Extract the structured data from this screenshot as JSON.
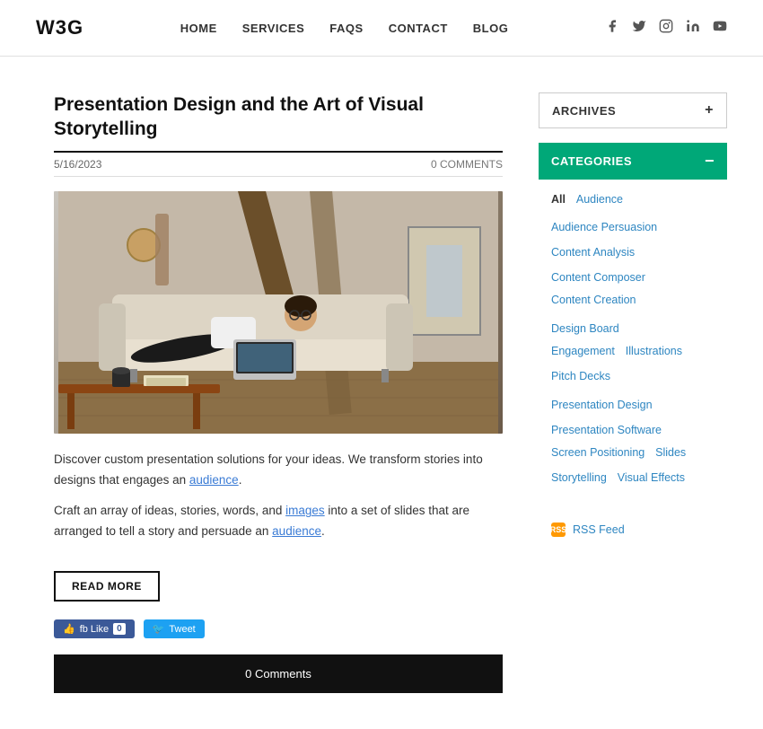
{
  "header": {
    "logo": "W3G",
    "nav": [
      {
        "label": "HOME",
        "href": "#"
      },
      {
        "label": "SERVICES",
        "href": "#"
      },
      {
        "label": "FAQS",
        "href": "#"
      },
      {
        "label": "CONTACT",
        "href": "#"
      },
      {
        "label": "BLOG",
        "href": "#"
      }
    ],
    "social": [
      {
        "name": "facebook-icon",
        "symbol": "f"
      },
      {
        "name": "twitter-icon",
        "symbol": "t"
      },
      {
        "name": "instagram-icon",
        "symbol": "i"
      },
      {
        "name": "linkedin-icon",
        "symbol": "in"
      },
      {
        "name": "youtube-icon",
        "symbol": "▶"
      }
    ]
  },
  "article": {
    "title": "Presentation Design and the Art of Visual Storytelling",
    "date": "5/16/2023",
    "comments_count": "0 COMMENTS",
    "body_paragraph1": "Discover custom presentation solutions for your ideas. We transform stories into designs that engages an audience.",
    "body_paragraph2": "Craft an array of ideas, stories, words, and images into a set of slides that are arranged to tell a story and persuade an audience.",
    "read_more_label": "READ MORE",
    "fb_label": "fb Like 0",
    "tweet_label": "Tweet",
    "comments_bar_text": "0 Comments"
  },
  "sidebar": {
    "archives_label": "ARCHIVES",
    "archives_toggle": "+",
    "categories_label": "CATEGORIES",
    "categories_toggle": "−",
    "categories": [
      {
        "label": "All",
        "special": true
      },
      {
        "label": "Audience"
      },
      {
        "label": "Audience Persuasion"
      },
      {
        "label": "Content Analysis"
      },
      {
        "label": "Content Composer"
      },
      {
        "label": "Content Creation"
      },
      {
        "label": "Design Board"
      },
      {
        "label": "Engagement"
      },
      {
        "label": "Illustrations"
      },
      {
        "label": "Pitch Decks"
      },
      {
        "label": "Presentation Design"
      },
      {
        "label": "Presentation Software"
      },
      {
        "label": "Screen Positioning"
      },
      {
        "label": "Slides"
      },
      {
        "label": "Storytelling"
      },
      {
        "label": "Visual Effects"
      }
    ],
    "rss_label": "RSS Feed"
  }
}
